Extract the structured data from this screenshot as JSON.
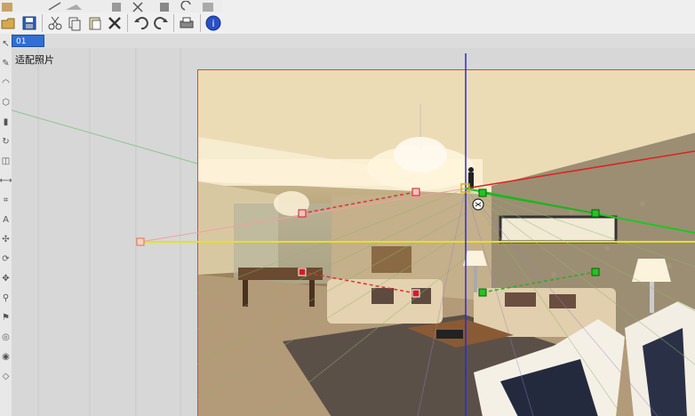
{
  "scene": {
    "tab_label": "01",
    "viewport_label": "适配照片"
  },
  "toolbar": {
    "icons": [
      "open-icon",
      "save-icon",
      "cut-icon",
      "copy-icon",
      "paste-icon",
      "erase-icon",
      "undo-icon",
      "redo-icon",
      "print-icon",
      "info-icon"
    ]
  },
  "colors": {
    "red_axis": "#e02020",
    "green_axis": "#22c422",
    "blue_axis": "#2020e0",
    "yellow_horizon": "#e6e02a",
    "tab_blue": "#2f6fd6"
  }
}
